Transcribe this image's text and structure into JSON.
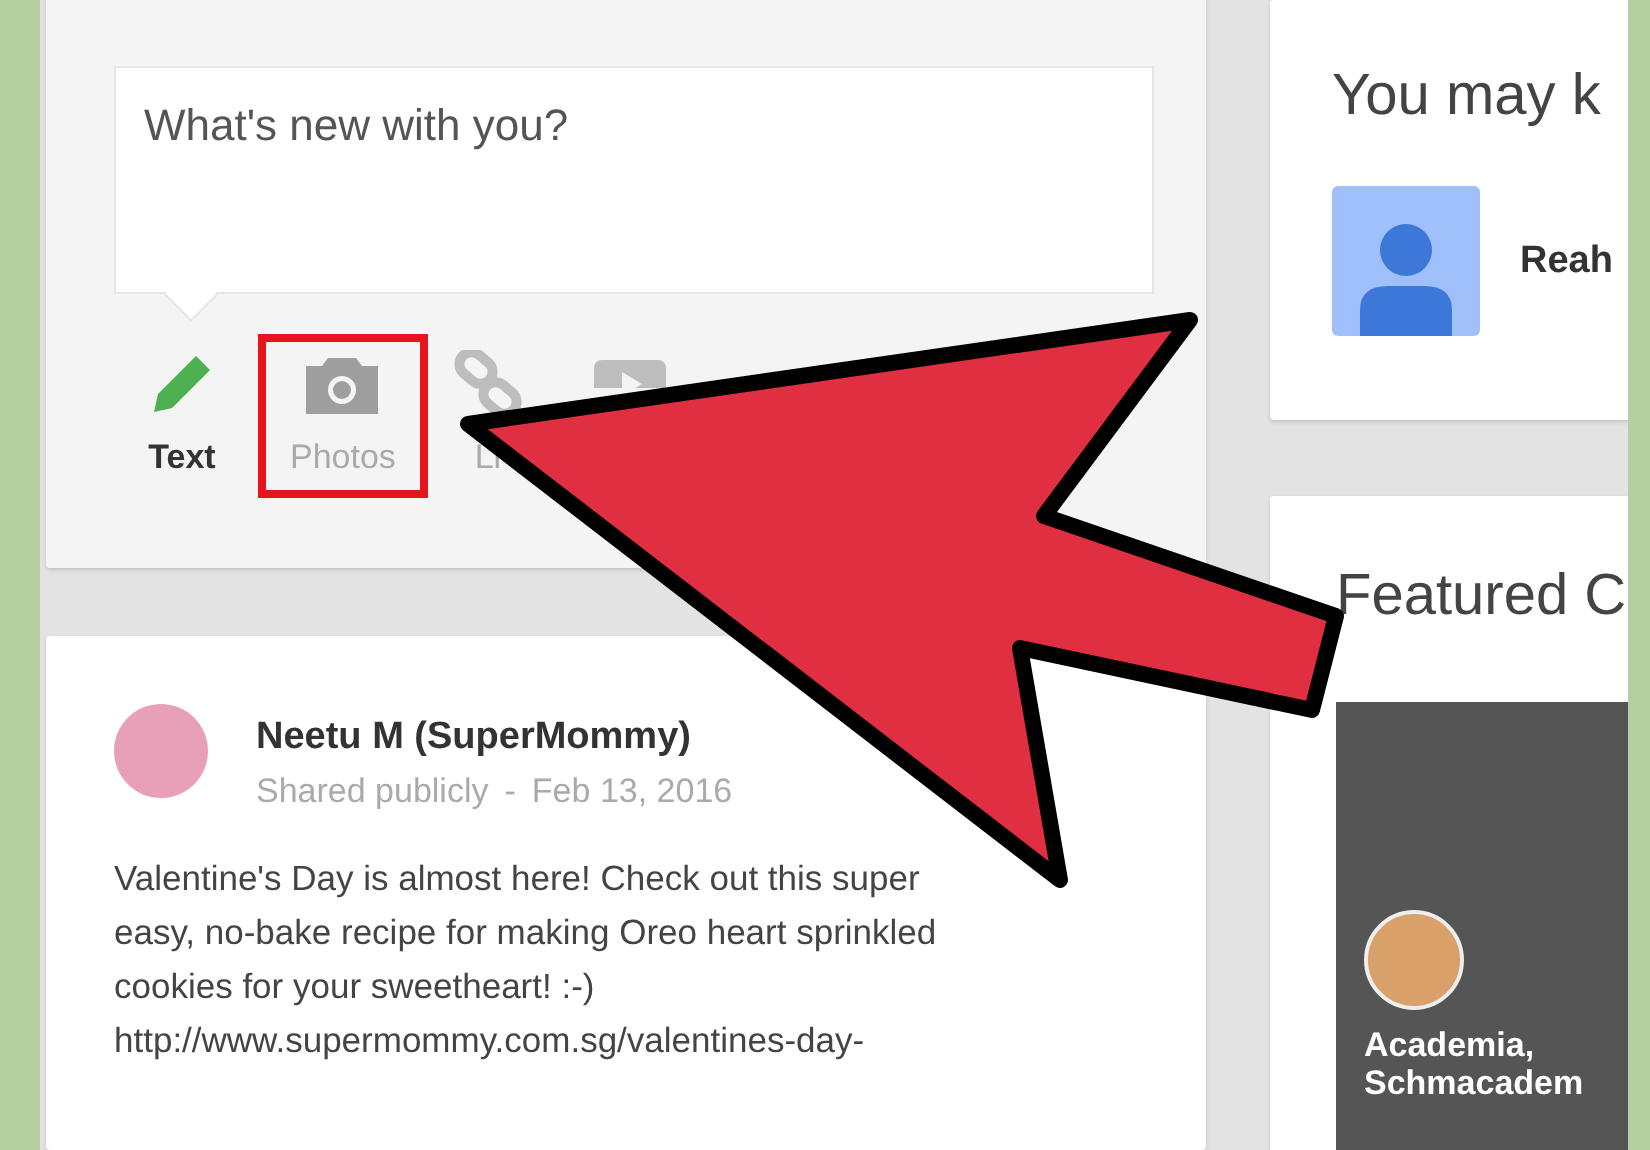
{
  "composer": {
    "placeholder": "What's new with you?",
    "actions": [
      {
        "kind": "pencil",
        "label": "Text",
        "selected": true,
        "highlighted": false
      },
      {
        "kind": "camera",
        "label": "Photos",
        "selected": false,
        "highlighted": true
      },
      {
        "kind": "link",
        "label": "Li",
        "selected": false,
        "highlighted": false
      },
      {
        "kind": "video",
        "selected": false,
        "highlighted": false
      }
    ]
  },
  "post": {
    "author": "Neetu M (SuperMommy)",
    "visibility": "Shared publicly",
    "separator": "-",
    "date": "Feb 13, 2016",
    "body": "Valentine's Day is almost here! Check out this super\neasy, no-bake recipe for making Oreo heart sprinkled\ncookies for your sweetheart!  :-)\nhttp://www.supermommy.com.sg/valentines-day-"
  },
  "suggestions": {
    "title": "You may k",
    "people": [
      {
        "name": "Reah"
      }
    ]
  },
  "featured": {
    "title": "Featured C",
    "collections": [
      {
        "name": "Academia,\nSchmacadem"
      }
    ]
  }
}
